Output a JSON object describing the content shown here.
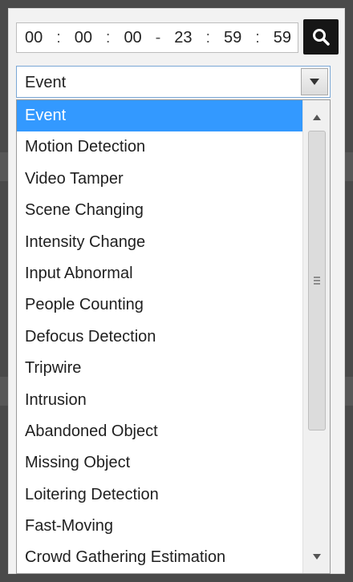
{
  "time_range": {
    "start": {
      "hh": "00",
      "mm": "00",
      "ss": "00"
    },
    "end": {
      "hh": "23",
      "mm": "59",
      "ss": "59"
    },
    "separator": ":",
    "range_separator": "-"
  },
  "search": {
    "icon": "search-icon"
  },
  "event_select": {
    "value": "Event",
    "options": [
      "Event",
      "Motion Detection",
      "Video Tamper",
      "Scene Changing",
      "Intensity Change",
      "Input Abnormal",
      "People Counting",
      "Defocus Detection",
      "Tripwire",
      "Intrusion",
      "Abandoned Object",
      "Missing Object",
      "Loitering Detection",
      "Fast-Moving",
      "Crowd Gathering Estimation"
    ],
    "selected_index": 0
  },
  "colors": {
    "selection": "#3399ff",
    "button_bg": "#161616",
    "select_border": "#7aa7d6"
  }
}
